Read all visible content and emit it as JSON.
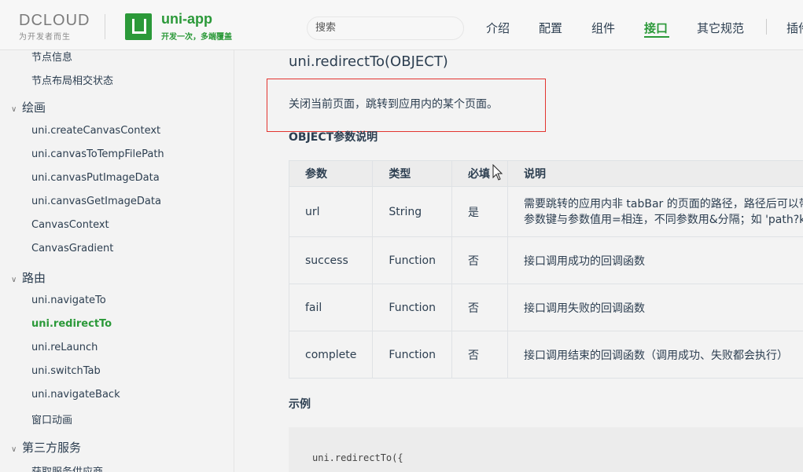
{
  "header": {
    "dcloud_logo_text": "DCLOUD",
    "dcloud_tagline": "为开发者而生",
    "product_name": "uni-app",
    "product_slogan": "开发一次，多端覆盖",
    "search_placeholder": "搜索",
    "nav": [
      {
        "label": "介绍"
      },
      {
        "label": "配置"
      },
      {
        "label": "组件"
      },
      {
        "label": "接口",
        "active": true
      },
      {
        "label": "其它规范"
      },
      {
        "label": "插件"
      }
    ]
  },
  "sidebar": {
    "items": [
      {
        "label": "节点信息",
        "type": "item"
      },
      {
        "label": "节点布局相交状态",
        "type": "item"
      },
      {
        "label": "绘画",
        "type": "group"
      },
      {
        "label": "uni.createCanvasContext",
        "type": "item"
      },
      {
        "label": "uni.canvasToTempFilePath",
        "type": "item"
      },
      {
        "label": "uni.canvasPutImageData",
        "type": "item"
      },
      {
        "label": "uni.canvasGetImageData",
        "type": "item"
      },
      {
        "label": "CanvasContext",
        "type": "item"
      },
      {
        "label": "CanvasGradient",
        "type": "item"
      },
      {
        "label": "路由",
        "type": "group"
      },
      {
        "label": "uni.navigateTo",
        "type": "item"
      },
      {
        "label": "uni.redirectTo",
        "type": "item",
        "active": true
      },
      {
        "label": "uni.reLaunch",
        "type": "item"
      },
      {
        "label": "uni.switchTab",
        "type": "item"
      },
      {
        "label": "uni.navigateBack",
        "type": "item"
      },
      {
        "label": "窗口动画",
        "type": "item"
      },
      {
        "label": "第三方服务",
        "type": "group"
      },
      {
        "label": "获取服务供应商",
        "type": "item"
      }
    ]
  },
  "main": {
    "api_title": "uni.redirectTo(OBJECT)",
    "description": "关闭当前页面，跳转到应用内的某个页面。",
    "params_heading": "OBJECT参数说明",
    "table": {
      "headers": [
        "参数",
        "类型",
        "必填",
        "说明"
      ],
      "rows": [
        {
          "name": "url",
          "type": "String",
          "required": "是",
          "desc_line1": "需要跳转的应用内非 tabBar 的页面的路径，路径后可以带",
          "desc_line2": "参数键与参数值用=相连，不同参数用&分隔；如 'path?key"
        },
        {
          "name": "success",
          "type": "Function",
          "required": "否",
          "desc_line1": "接口调用成功的回调函数"
        },
        {
          "name": "fail",
          "type": "Function",
          "required": "否",
          "desc_line1": "接口调用失败的回调函数"
        },
        {
          "name": "complete",
          "type": "Function",
          "required": "否",
          "desc_line1": "接口调用结束的回调函数（调用成功、失败都会执行）"
        }
      ]
    },
    "example_heading": "示例",
    "code_line1": "uni.redirectTo({"
  },
  "colors": {
    "accent": "#2b9939",
    "highlight_border": "#e3342f"
  }
}
